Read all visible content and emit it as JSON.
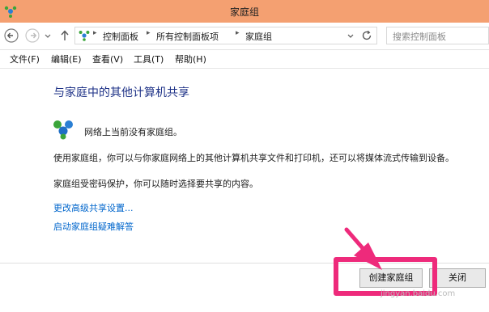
{
  "window": {
    "title": "家庭组"
  },
  "nav": {
    "breadcrumb": [
      "控制面板",
      "所有控制面板项",
      "家庭组"
    ],
    "search_placeholder": "搜索控制面板"
  },
  "menu": [
    "文件(F)",
    "编辑(E)",
    "查看(V)",
    "工具(T)",
    "帮助(H)"
  ],
  "content": {
    "heading": "与家庭中的其他计算机共享",
    "status": "网络上当前没有家庭组。",
    "paragraph1": "使用家庭组，你可以与你家庭网络上的其他计算机共享文件和打印机，还可以将媒体流式传输到设备。",
    "paragraph2": "家庭组受密码保护，你可以随时选择要共享的内容。",
    "links": [
      "更改高级共享设置...",
      "启动家庭组疑难解答"
    ]
  },
  "buttons": {
    "create": "创建家庭组",
    "close": "关闭"
  },
  "watermark": "jingyan.baidu.com",
  "colors": {
    "titlebar": "#f4a071",
    "heading": "#1e3287",
    "link": "#0066cc",
    "annotation": "#ee2a7b"
  }
}
